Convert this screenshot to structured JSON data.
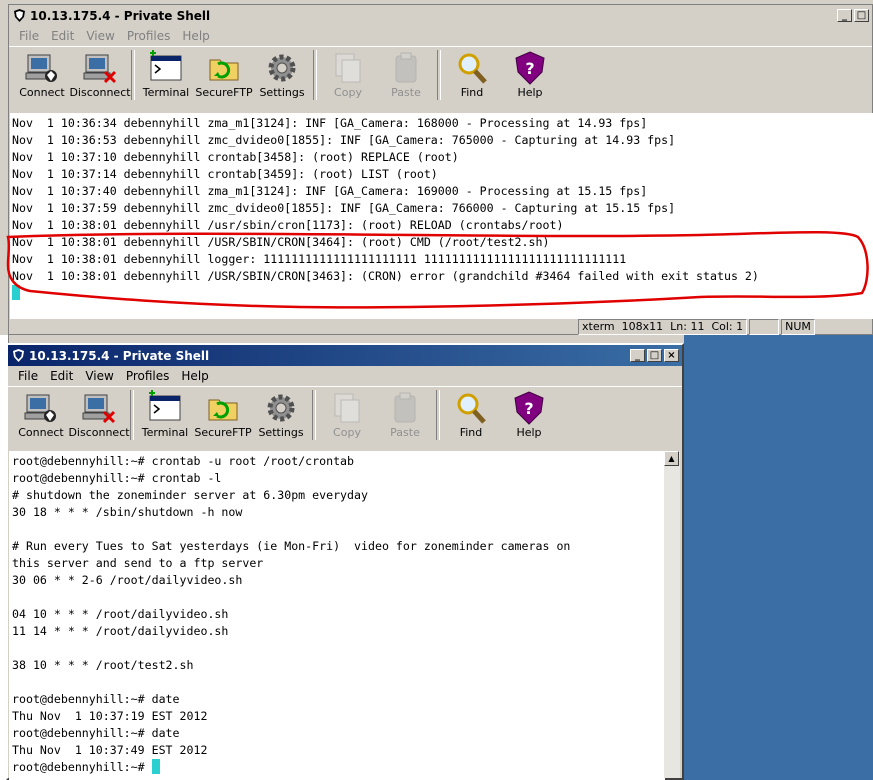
{
  "window_top": {
    "title": "10.13.175.4 - Private Shell",
    "menu": [
      "File",
      "Edit",
      "View",
      "Profiles",
      "Help"
    ],
    "toolbar": [
      {
        "label": "Connect",
        "icon": "connect-icon",
        "enabled": true
      },
      {
        "label": "Disconnect",
        "icon": "disconnect-icon",
        "enabled": true
      },
      {
        "label": "Terminal",
        "icon": "terminal-icon",
        "enabled": true
      },
      {
        "label": "SecureFTP",
        "icon": "secureftp-icon",
        "enabled": true
      },
      {
        "label": "Settings",
        "icon": "gear-icon",
        "enabled": true
      },
      {
        "label": "Copy",
        "icon": "copy-icon",
        "enabled": false
      },
      {
        "label": "Paste",
        "icon": "paste-icon",
        "enabled": false
      },
      {
        "label": "Find",
        "icon": "find-icon",
        "enabled": true
      },
      {
        "label": "Help",
        "icon": "help-icon",
        "enabled": true
      }
    ],
    "lines": [
      "Nov  1 10:36:34 debennyhill zma_m1[3124]: INF [GA_Camera: 168000 - Processing at 14.93 fps]",
      "Nov  1 10:36:53 debennyhill zmc_dvideo0[1855]: INF [GA_Camera: 765000 - Capturing at 14.93 fps]",
      "Nov  1 10:37:10 debennyhill crontab[3458]: (root) REPLACE (root)",
      "Nov  1 10:37:14 debennyhill crontab[3459]: (root) LIST (root)",
      "Nov  1 10:37:40 debennyhill zma_m1[3124]: INF [GA_Camera: 169000 - Processing at 15.15 fps]",
      "Nov  1 10:37:59 debennyhill zmc_dvideo0[1855]: INF [GA_Camera: 766000 - Capturing at 15.15 fps]",
      "Nov  1 10:38:01 debennyhill /usr/sbin/cron[1173]: (root) RELOAD (crontabs/root)",
      "Nov  1 10:38:01 debennyhill /USR/SBIN/CRON[3464]: (root) CMD (/root/test2.sh)",
      "Nov  1 10:38:01 debennyhill logger: 1111111111111111111111 11111111111111111111111111111",
      "Nov  1 10:38:01 debennyhill /USR/SBIN/CRON[3463]: (CRON) error (grandchild #3464 failed with exit status 2)"
    ],
    "status": {
      "term": "xterm",
      "size": "108x11",
      "ln": "Ln: 11",
      "col": "Col: 1",
      "num": "NUM"
    },
    "highlight_color": "#e00000"
  },
  "window_bottom": {
    "title": "10.13.175.4 - Private Shell",
    "menu": [
      "File",
      "Edit",
      "View",
      "Profiles",
      "Help"
    ],
    "lines": [
      "root@debennyhill:~# crontab -u root /root/crontab",
      "root@debennyhill:~# crontab -l",
      "# shutdown the zoneminder server at 6.30pm everyday",
      "30 18 * * * /sbin/shutdown -h now",
      "",
      "# Run every Tues to Sat yesterdays (ie Mon-Fri)  video for zoneminder cameras on",
      "this server and send to a ftp server",
      "30 06 * * 2-6 /root/dailyvideo.sh",
      "",
      "04 10 * * * /root/dailyvideo.sh",
      "11 14 * * * /root/dailyvideo.sh",
      "",
      "38 10 * * * /root/test2.sh",
      "",
      "root@debennyhill:~# date",
      "Thu Nov  1 10:37:19 EST 2012",
      "root@debennyhill:~# date",
      "Thu Nov  1 10:37:49 EST 2012",
      "root@debennyhill:~# "
    ]
  },
  "colors": {
    "titlebar_active": "#0a246a",
    "desktop_blue": "#3a6ea5",
    "cursor": "#2ad0d0"
  }
}
